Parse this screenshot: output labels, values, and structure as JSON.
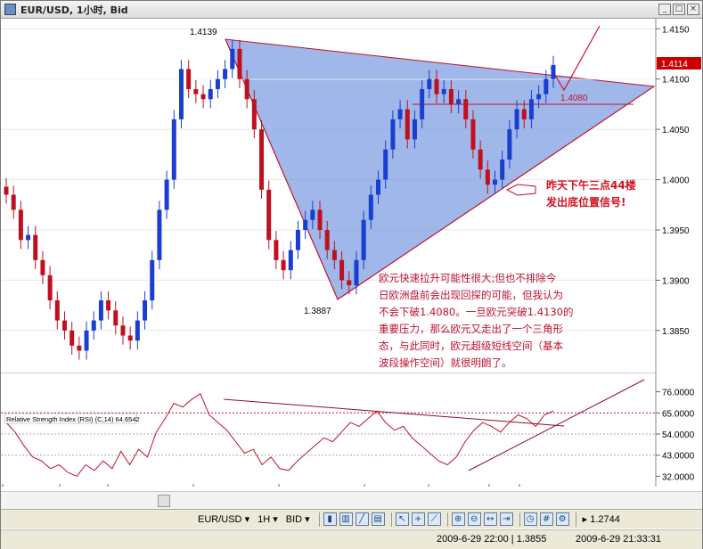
{
  "window": {
    "title": "EUR/USD, 1小时, Bid"
  },
  "price_axis": {
    "ticks": [
      "1.4150",
      "1.4100",
      "1.4050",
      "1.4000",
      "1.3950",
      "1.3900",
      "1.3850"
    ],
    "current_price": "1.4114",
    "current_color": "#cc0000"
  },
  "rsi_axis": {
    "ticks": [
      "76.0000",
      "65.0000",
      "54.0000",
      "43.0000",
      "32.0000"
    ],
    "indicator_label": "Relative Strength Index (RSI) (C,14) 64.6542"
  },
  "time_axis": {
    "labels": [
      "六月.21",
      "8:00",
      "六月.23 8:00",
      "六月.24 8:00",
      "六月.25 8:00",
      "六月.26 8:00",
      "六月.28",
      "8:00",
      "18:00"
    ]
  },
  "annotations": {
    "high_label": "1.4139",
    "low_label": "1.3887",
    "level_label": "1.4080",
    "signal_note": [
      "昨天下午三点44楼",
      "发出底位置信号!"
    ],
    "commentary": [
      "欧元快速拉升可能性很大;但也不排除今",
      "日欧洲盘前会出现回探的可能，但我认为",
      "不会下破1.4080。一旦欧元突破1.4130的",
      "重要压力，那么欧元又走出了一个三角形",
      "态，与此同时，欧元超级短线空间（基本",
      "波段操作空间）就很明朗了。"
    ]
  },
  "toolbar": {
    "symbol": "EUR/USD",
    "timeframe": "1H",
    "price_type": "BID",
    "zoom_value": "1.2744"
  },
  "status": {
    "left": "2009-6-29 22:00  |  1.3855",
    "right": "2009-6-29 21:33:31"
  },
  "chart_data": {
    "type": "candlestick",
    "series": [
      {
        "name": "EUR/USD",
        "close": [
          1.3985,
          1.397,
          1.394,
          1.3945,
          1.392,
          1.3905,
          1.388,
          1.386,
          1.385,
          1.3835,
          1.383,
          1.385,
          1.386,
          1.388,
          1.387,
          1.3855,
          1.3845,
          1.384,
          1.386,
          1.388,
          1.392,
          1.397,
          1.4,
          1.406,
          1.411,
          1.409,
          1.4085,
          1.408,
          1.409,
          1.41,
          1.411,
          1.413,
          1.41,
          1.408,
          1.405,
          1.399,
          1.394,
          1.392,
          1.391,
          1.393,
          1.395,
          1.396,
          1.397,
          1.395,
          1.393,
          1.392,
          1.39,
          1.3895,
          1.392,
          1.396,
          1.3985,
          1.4,
          1.403,
          1.406,
          1.407,
          1.404,
          1.406,
          1.409,
          1.41,
          1.4085,
          1.409,
          1.4075,
          1.408,
          1.406,
          1.403,
          1.401,
          1.3995,
          1.4,
          1.402,
          1.405,
          1.407,
          1.406,
          1.408,
          1.4085,
          1.41,
          1.4114
        ]
      }
    ],
    "price_range": [
      1.381,
      1.416
    ],
    "rsi": {
      "values": [
        60,
        55,
        48,
        42,
        40,
        36,
        38,
        34,
        32,
        38,
        35,
        40,
        36,
        45,
        38,
        46,
        42,
        55,
        62,
        70,
        68,
        72,
        75,
        64,
        60,
        56,
        50,
        44,
        46,
        38,
        42,
        36,
        35,
        40,
        44,
        48,
        52,
        50,
        55,
        60,
        58,
        62,
        66,
        60,
        56,
        58,
        52,
        48,
        44,
        40,
        38,
        42,
        50,
        56,
        60,
        58,
        55,
        60,
        64,
        62,
        58,
        64,
        66
      ],
      "range": [
        28,
        80
      ],
      "levels": [
        65,
        54,
        43
      ]
    },
    "ylim": [
      1.381,
      1.416
    ],
    "grid": true
  }
}
